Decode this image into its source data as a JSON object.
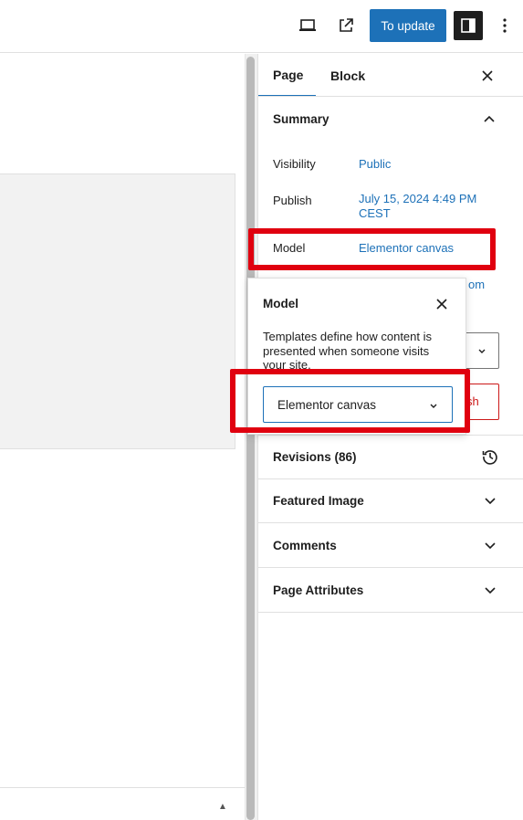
{
  "topbar": {
    "update_label": "To update",
    "icons": [
      "desktop-preview-icon",
      "external-link-icon",
      "sidebar-toggle-icon",
      "more-options-icon"
    ]
  },
  "sidebar": {
    "tabs": [
      {
        "label": "Page"
      },
      {
        "label": "Block"
      }
    ],
    "summary": {
      "title": "Summary",
      "visibility_label": "Visibility",
      "visibility_value": "Public",
      "publish_label": "Publish",
      "publish_value_line1": "July 15, 2024 4:49 PM",
      "publish_value_line2": "CEST",
      "model_label": "Model",
      "model_value": "Elementor canvas",
      "hidden_link_fragment": "om",
      "hidden_button_fragment": "sh"
    },
    "panels": [
      {
        "title": "Revisions (86)"
      },
      {
        "title": "Featured Image"
      },
      {
        "title": "Comments"
      },
      {
        "title": "Page Attributes"
      }
    ]
  },
  "popover": {
    "title": "Model",
    "description_line1": "Templates define how content is",
    "description_line2": "presented when someone visits",
    "description_line3": "your site.",
    "select_value": "Elementor canvas"
  },
  "colors": {
    "accent": "#1d71b8",
    "highlight": "#e0000f",
    "danger": "#cc1818"
  }
}
